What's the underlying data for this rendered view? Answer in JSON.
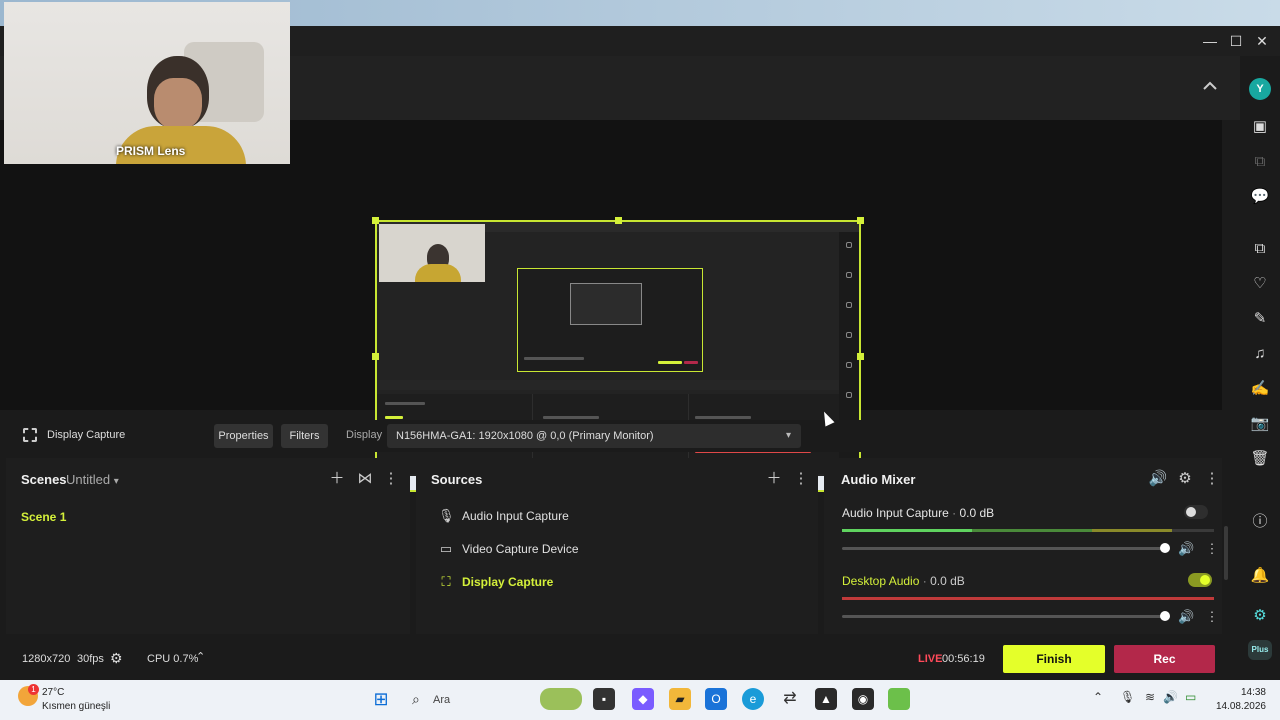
{
  "window": {
    "minimize": "—",
    "maximize": "☐",
    "close": "✕"
  },
  "webcam": {
    "label": "PRISM Lens"
  },
  "source_toolbar": {
    "source_name": "Display Capture",
    "properties_label": "Properties",
    "filters_label": "Filters",
    "display_label": "Display",
    "display_value": "N156HMA-GA1: 1920x1080 @ 0,0 (Primary Monitor)"
  },
  "scenes": {
    "title": "Scenes",
    "collection": "Untitled",
    "items": [
      "Scene 1"
    ]
  },
  "sources": {
    "title": "Sources",
    "items": [
      {
        "label": "Audio Input Capture",
        "icon": "microphone-icon"
      },
      {
        "label": "Video Capture Device",
        "icon": "camera-icon"
      },
      {
        "label": "Display Capture",
        "icon": "display-capture-icon"
      }
    ]
  },
  "mixer": {
    "title": "Audio Mixer",
    "channels": [
      {
        "name": "Audio Input Capture",
        "level": "0.0 dB",
        "enabled": false,
        "accent": "#5fd35f"
      },
      {
        "name": "Desktop Audio",
        "level": "0.0 dB",
        "enabled": true,
        "accent": "#e04848"
      }
    ]
  },
  "status": {
    "resolution": "1280x720",
    "fps": "30fps",
    "cpu": "CPU 0.7%",
    "live_label": "LIVE",
    "timer": "00:56:19",
    "finish_label": "Finish",
    "rec_label": "Rec"
  },
  "sidebar": {
    "avatar_letter": "Y",
    "plus_label": "Plus"
  },
  "taskbar": {
    "temperature": "27°C",
    "weather": "Kısmen güneşli",
    "weather_badge": "1",
    "search_placeholder": "Ara",
    "time": "14:38",
    "date": "14.08.2026"
  },
  "colors": {
    "accent": "#d4f03a",
    "finish": "#e4ff2a",
    "rec": "#b3284a",
    "live": "#ff4a5a"
  }
}
